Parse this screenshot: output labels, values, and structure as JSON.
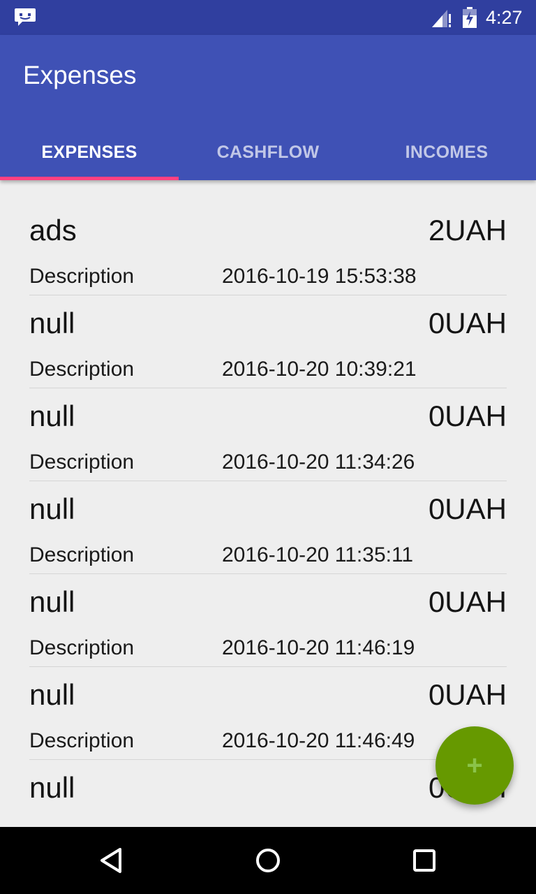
{
  "status_bar": {
    "time": "4:27",
    "icons": [
      "message-notification-icon",
      "signal-icon",
      "battery-charging-icon"
    ]
  },
  "app_bar": {
    "title": "Expenses"
  },
  "tabs": [
    {
      "label": "EXPENSES",
      "active": true
    },
    {
      "label": "CASHFLOW",
      "active": false
    },
    {
      "label": "INCOMES",
      "active": false
    }
  ],
  "items": [
    {
      "name": "ads",
      "amount": "2UAH",
      "description": "Description",
      "date": "2016-10-19 15:53:38"
    },
    {
      "name": "null",
      "amount": "0UAH",
      "description": "Description",
      "date": "2016-10-20 10:39:21"
    },
    {
      "name": "null",
      "amount": "0UAH",
      "description": "Description",
      "date": "2016-10-20 11:34:26"
    },
    {
      "name": "null",
      "amount": "0UAH",
      "description": "Description",
      "date": "2016-10-20 11:35:11"
    },
    {
      "name": "null",
      "amount": "0UAH",
      "description": "Description",
      "date": "2016-10-20 11:46:19"
    },
    {
      "name": "null",
      "amount": "0UAH",
      "description": "Description",
      "date": "2016-10-20 11:46:49"
    },
    {
      "name": "null",
      "amount": "0UAH",
      "description": "",
      "date": ""
    }
  ],
  "fab": {
    "label": "+",
    "icon": "add-icon",
    "color": "#669900"
  },
  "nav_bar": {
    "buttons": [
      "back-icon",
      "home-icon",
      "recent-apps-icon"
    ]
  },
  "colors": {
    "primary": "#3f51b5",
    "primary_dark": "#303f9f",
    "accent": "#ff4081"
  }
}
